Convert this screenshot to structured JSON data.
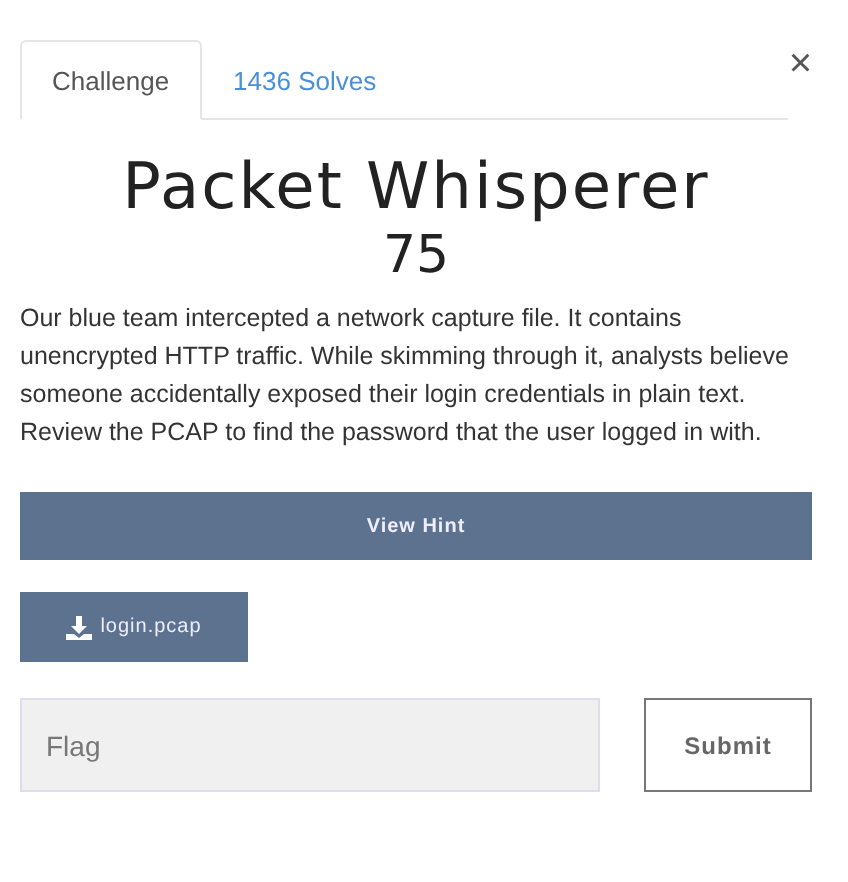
{
  "tabs": [
    {
      "label": "Challenge",
      "selected": true
    },
    {
      "label": "1436 Solves",
      "selected": false
    }
  ],
  "close": "×",
  "title": "Packet Whisperer",
  "points": "75",
  "description": "Our blue team intercepted a network capture file. It contains unencrypted HTTP traffic. While skimming through it, analysts believe someone accidentally exposed their login credentials in plain text. Review the PCAP to find the password that the user logged in with.",
  "hint_button": "View Hint",
  "file_button": "login.pcap",
  "flag": {
    "placeholder": "Flag"
  },
  "submit_button": "Submit"
}
